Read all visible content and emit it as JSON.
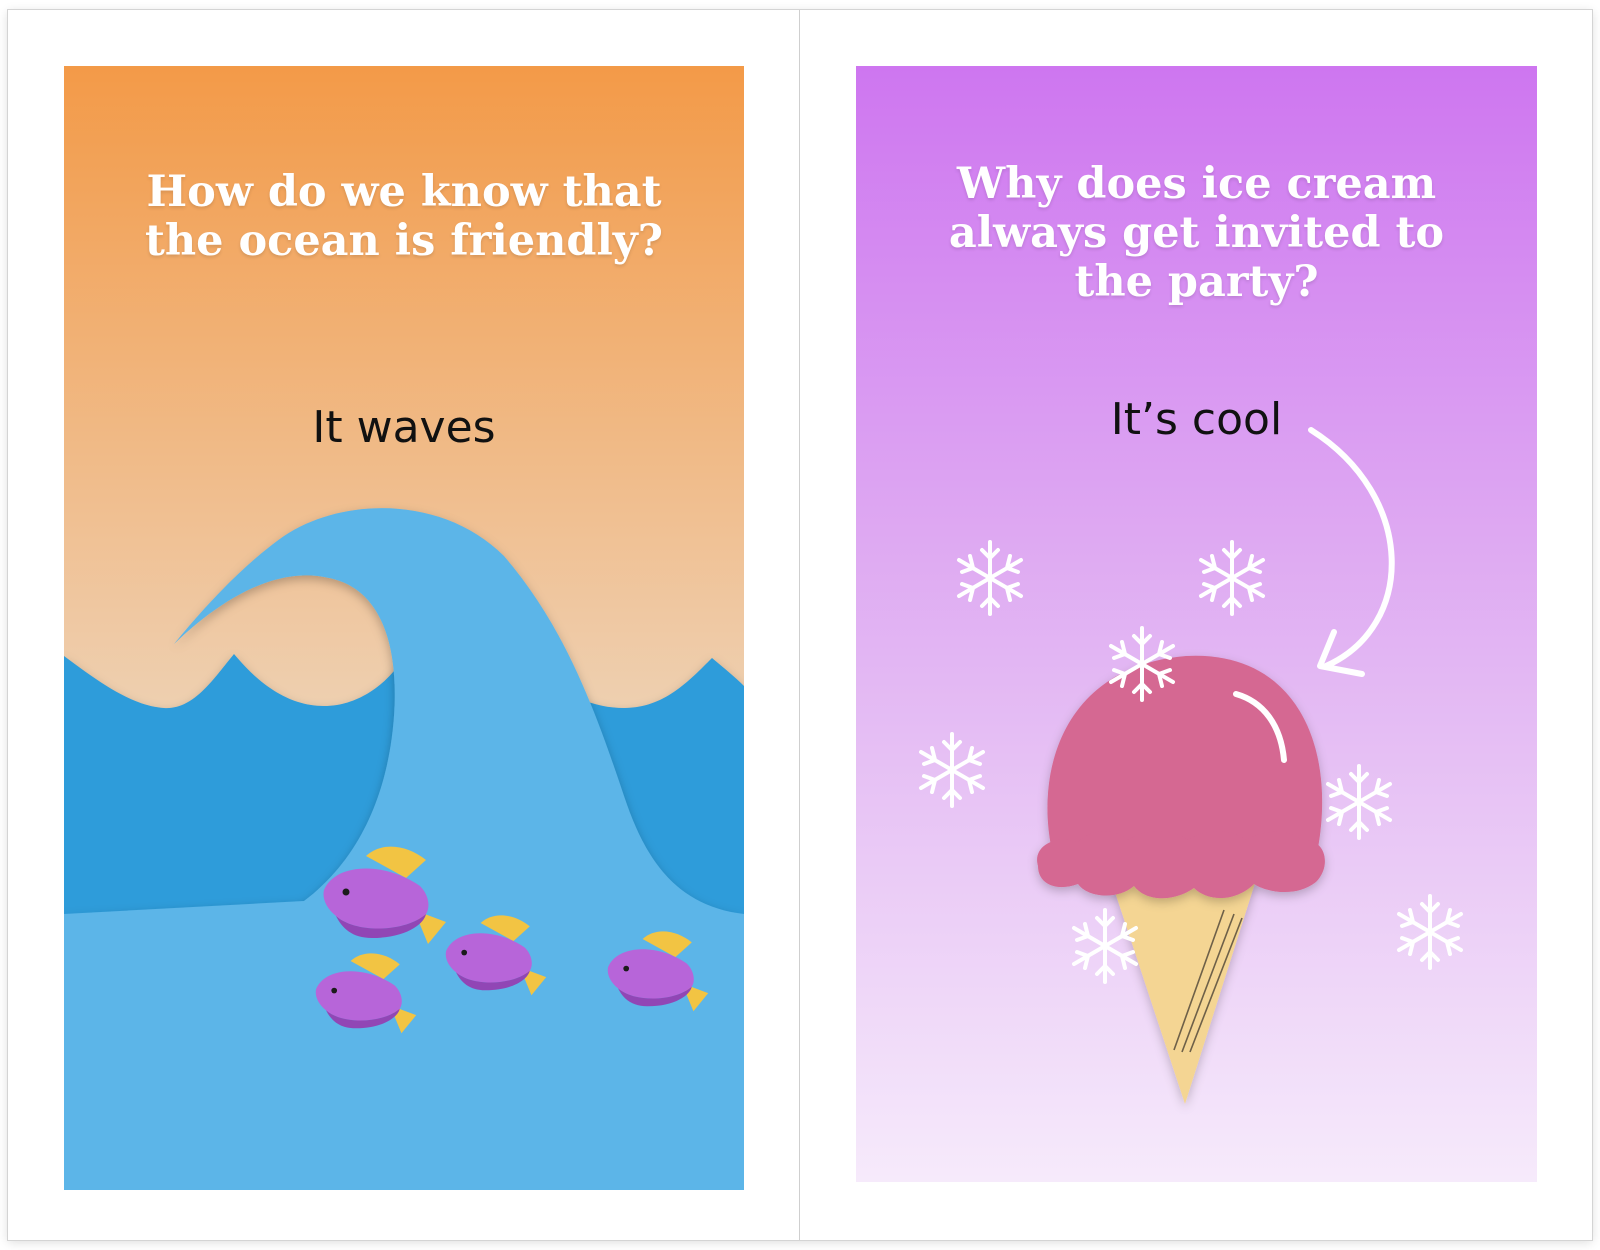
{
  "pages": [
    {
      "question": "How do we know that the ocean is friendly?",
      "answer": "It waves",
      "colors": {
        "top": "#f39a48",
        "bottom": "#ecdcc6",
        "wave_dark": "#2e9cda",
        "wave_light": "#5cb5e8",
        "fish_body": "#b765d9",
        "fish_fin": "#f2c443"
      }
    },
    {
      "question": "Why does ice cream always get invited to the party?",
      "answer": "It’s cool",
      "colors": {
        "top": "#ce76f0",
        "bottom": "#f6eafb",
        "scoop": "#d56792",
        "cone": "#f4d593",
        "snowflake": "#ffffff"
      }
    }
  ]
}
